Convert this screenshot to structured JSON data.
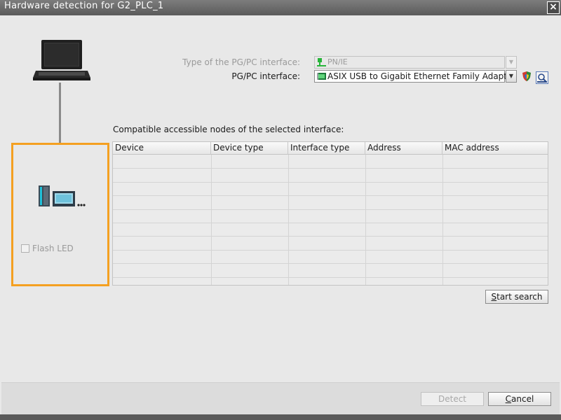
{
  "window": {
    "title": "Hardware detection for G2_PLC_1",
    "close_glyph": "×"
  },
  "interface": {
    "type_label": "Type of the PG/PC interface:",
    "type_value": "PN/IE",
    "pgpc_label": "PG/PC interface:",
    "pgpc_value": "ASIX USB to Gigabit Ethernet Family Adapter"
  },
  "nodes": {
    "heading": "Compatible accessible nodes of the selected interface:",
    "columns": [
      "Device",
      "Device type",
      "Interface type",
      "Address",
      "MAC address"
    ],
    "rows": []
  },
  "device_panel": {
    "flash_label": "Flash LED",
    "flash_checked": false,
    "highlight_color": "#f4a021"
  },
  "buttons": {
    "start_search_u": "S",
    "start_search_rest": "tart search",
    "detect": "Detect",
    "cancel_u": "C",
    "cancel_rest": "ancel"
  },
  "icons": {
    "laptop": "laptop-icon",
    "device": "plc-device-icon",
    "network": "network-icon",
    "adapter": "network-adapter-icon",
    "shield": "shield-icon",
    "search": "magnifier-icon"
  }
}
